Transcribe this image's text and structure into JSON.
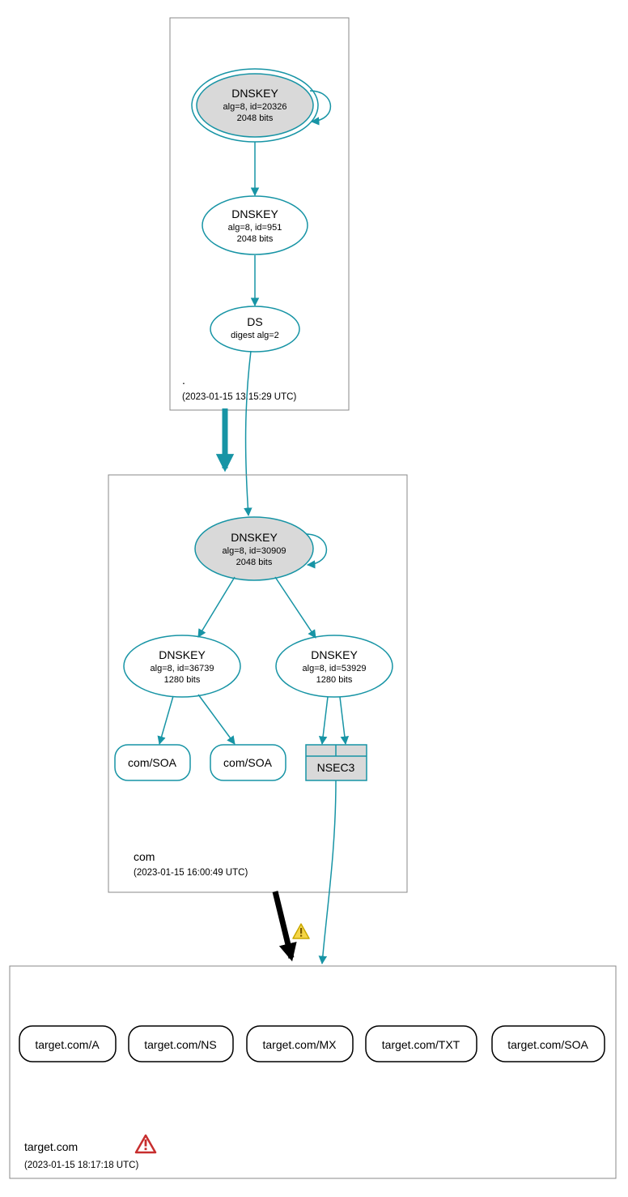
{
  "zones": {
    "root": {
      "label": ".",
      "timestamp": "(2023-01-15 13:15:29 UTC)",
      "nodes": {
        "ksk": {
          "title": "DNSKEY",
          "line2": "alg=8, id=20326",
          "line3": "2048 bits"
        },
        "zsk": {
          "title": "DNSKEY",
          "line2": "alg=8, id=951",
          "line3": "2048 bits"
        },
        "ds": {
          "title": "DS",
          "line2": "digest alg=2"
        }
      }
    },
    "com": {
      "label": "com",
      "timestamp": "(2023-01-15 16:00:49 UTC)",
      "nodes": {
        "ksk": {
          "title": "DNSKEY",
          "line2": "alg=8, id=30909",
          "line3": "2048 bits"
        },
        "zsk1": {
          "title": "DNSKEY",
          "line2": "alg=8, id=36739",
          "line3": "1280 bits"
        },
        "zsk2": {
          "title": "DNSKEY",
          "line2": "alg=8, id=53929",
          "line3": "1280 bits"
        },
        "soa1": {
          "title": "com/SOA"
        },
        "soa2": {
          "title": "com/SOA"
        },
        "nsec3": {
          "title": "NSEC3"
        }
      }
    },
    "target": {
      "label": "target.com",
      "timestamp": "(2023-01-15 18:17:18 UTC)",
      "nodes": {
        "a": {
          "title": "target.com/A"
        },
        "ns": {
          "title": "target.com/NS"
        },
        "mx": {
          "title": "target.com/MX"
        },
        "txt": {
          "title": "target.com/TXT"
        },
        "soa": {
          "title": "target.com/SOA"
        }
      }
    }
  },
  "colors": {
    "secure": "#1794a5",
    "insecure": "#000000",
    "fill_grey": "#d9d9d9"
  }
}
